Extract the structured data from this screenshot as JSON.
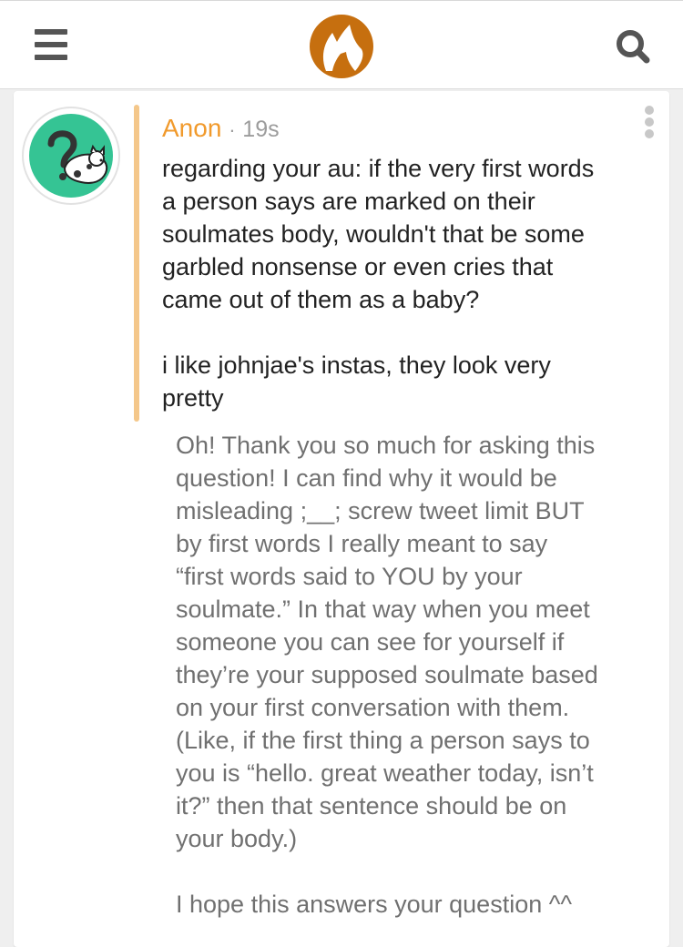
{
  "header": {
    "menu_icon": "hamburger-menu-icon",
    "logo_icon": "fox-logo-icon",
    "search_icon": "search-icon"
  },
  "post": {
    "author": "Anon",
    "separator": "·",
    "timestamp": "19s",
    "more_icon": "vertical-ellipsis-icon",
    "avatar_icon": "question-mark-cat-avatar",
    "question_paragraphs": [
      "regarding your au: if the very first words\na person says are marked on their\nsoulmates body, wouldn't that be some\ngarbled nonsense or even cries that\ncame out of them as a baby?",
      "i like johnjae's instas, they look very\npretty"
    ],
    "answer_paragraphs": [
      "Oh! Thank you so much for asking this\nquestion! I can find why it would be\nmisleading ;__; screw tweet limit BUT\nby first words I really meant to say\n“first words said to YOU by your\nsoulmate.” In that way when you meet\nsomeone you can see for yourself if\nthey’re your supposed soulmate based\non your first conversation with them.\n(Like, if the first thing a person says to\nyou is “hello. great weather today, isn’t\nit?” then that sentence should be on\nyour body.)",
      "I hope this answers your question ^^"
    ]
  },
  "colors": {
    "accent_orange": "#f19a2c",
    "logo_orange": "#c66f0f",
    "quote_bar": "#f4c78a",
    "avatar_green": "#35c494",
    "icon_gray": "#555555"
  }
}
